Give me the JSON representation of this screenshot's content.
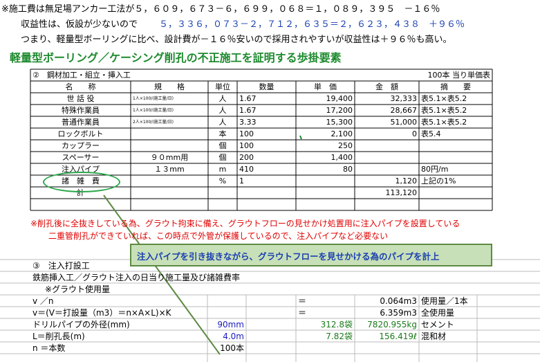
{
  "top_lines": {
    "line1": "※施工費は無足場アンカー工法が５，６０９，６７３－６，６９９，０６８＝１，０８９，３９５　－１６％",
    "line2_label": "収益性は、仮設が少ないので",
    "line2_value": "５，３３６，０７３－２，７１２，６３５＝２，６２３，４３８　＋９６％",
    "line3": "つまり、軽量型ボーリングに比べ、設計費が－１６％安いので採用されやすいが収益性は＋９６％も高い。"
  },
  "heading": "軽量型ボーリング／ケーシング削孔の不正施工を証明する歩掛要素",
  "table1": {
    "section_title": "②　鋼材加工・組立・挿入工",
    "unit_note": "100本 当り単価表",
    "headers": [
      "名　　称",
      "規　　格",
      "単位",
      "数量",
      "単　価",
      "金　額",
      "摘　　要"
    ],
    "rows": [
      {
        "name": "世 話 役",
        "spec": "1人×100/(施工量/日)",
        "unit": "人",
        "qty": "1.67",
        "price": "19,400",
        "amount": "32,333",
        "note": "表5.1×表5.2"
      },
      {
        "name": "特殊作業員",
        "spec": "1人×100/(施工量/日)",
        "unit": "人",
        "qty": "1.67",
        "price": "17,200",
        "amount": "28,667",
        "note": "表5.1×表5.2"
      },
      {
        "name": "普通作業員",
        "spec": "2人×100/(施工量/日)",
        "unit": "人",
        "qty": "3.33",
        "price": "15,300",
        "amount": "51,000",
        "note": "表5.1×表5.2"
      },
      {
        "name": "ロックボルト",
        "spec": "",
        "unit": "本",
        "qty": "100",
        "price": "2,100",
        "amount": "0",
        "note": "表5.4"
      },
      {
        "name": "カップラー",
        "spec": "",
        "unit": "個",
        "qty": "100",
        "price": "250",
        "amount": "",
        "note": ""
      },
      {
        "name": "スペーサー",
        "spec": "９０mm用",
        "unit": "個",
        "qty": "200",
        "price": "1,400",
        "amount": "",
        "note": ""
      },
      {
        "name": "注入パイプ",
        "spec": "１３mm",
        "unit": "m",
        "qty": "410",
        "price": "80",
        "amount": "",
        "note": "80円/m"
      },
      {
        "name": "諸　雑　費",
        "spec": "",
        "unit": "%",
        "qty": "1",
        "price": "",
        "amount": "1,120",
        "note": "上記の1%"
      },
      {
        "name": "計",
        "spec": "",
        "unit": "",
        "qty": "",
        "price": "",
        "amount": "113,120",
        "note": ""
      }
    ]
  },
  "red_notes": {
    "line1": "※削孔後に全抜きしている為、グラウト拘束に備え、グラウトフローの見せかけ処置用に注入パイプを設置している",
    "line2": "二重管削孔ができていれば、この時点で外管が保護しているので、注入パイプなど必要ない"
  },
  "callout": "注入パイプを引き抜きながら、グラウトフローを見せかける為のパイプを計上",
  "section3": {
    "title": "③　注入打設工",
    "subtitle": "鉄筋挿入工／グラウト注入の日当り施工量及び諸雑費率",
    "grout_label": "※グラウト使用量",
    "rows": [
      {
        "a": "v ／n",
        "b": "",
        "c": "",
        "eq": "＝",
        "val": "0.064m3",
        "desc": "使用量／1本"
      },
      {
        "a": "v＝(V＝打設量（m3）＝n×A×L)×K",
        "b": "",
        "c": "",
        "eq": "＝",
        "val": "6.359m3",
        "desc": "全使用量"
      },
      {
        "a": "ドリルパイプの外径(mm)",
        "b": "90mm",
        "c": "312.8袋",
        "eq": "",
        "val": "7820.955kg",
        "desc": "セメント"
      },
      {
        "a": "L＝削孔長(m)",
        "b": "4.0m",
        "c": "7.82袋",
        "eq": "",
        "val": "156.419ℓ",
        "desc": "混和材"
      },
      {
        "a": "n ＝本数",
        "b": "100本",
        "c": "",
        "eq": "",
        "val": "",
        "desc": ""
      }
    ]
  }
}
